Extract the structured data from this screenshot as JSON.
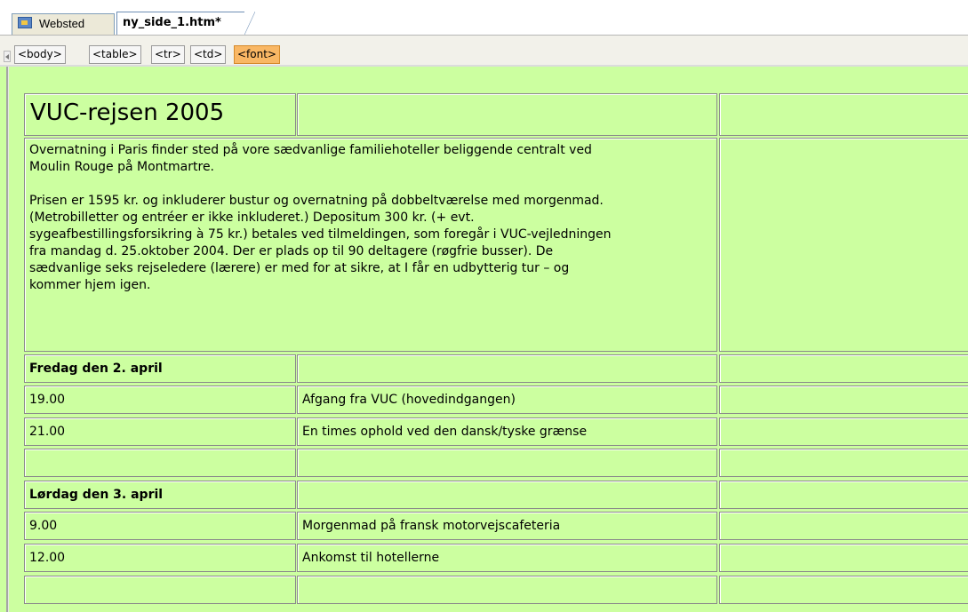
{
  "tabs": {
    "site_label": "Websted",
    "page_label": "ny_side_1.htm*"
  },
  "tag_selector": [
    "<body>",
    "<table>",
    "<tr>",
    "<td>",
    "<font>"
  ],
  "page": {
    "title": "VUC-rejsen 2005",
    "intro": [
      "Overnatning i Paris finder sted på vore sædvanlige familiehoteller beliggende centralt ved",
      "Moulin Rouge på Montmartre.",
      "",
      "Prisen er 1595 kr. og inkluderer bustur og overnatning på dobbeltværelse med morgenmad.",
      "(Metrobilletter og entréer er ikke inkluderet.) Depositum 300 kr. (+ evt.",
      "sygeafbestillingsforsikring à 75 kr.) betales ved tilmeldingen, som foregår i VUC-vejledningen",
      "fra mandag d. 25.oktober 2004. Der er plads op til 90 deltagere (røgfrie busser). De",
      "sædvanlige seks rejseledere (lærere) er med for at sikre, at I får en udbytterig tur – og",
      "kommer hjem igen."
    ],
    "day1": "Fredag den 2. april",
    "day1_rows": [
      {
        "time": "19.00",
        "activity": "Afgang fra VUC (hovedindgangen)"
      },
      {
        "time": "21.00",
        "activity": "En times ophold ved den dansk/tyske grænse"
      }
    ],
    "day2": "Lørdag den 3. april",
    "day2_rows": [
      {
        "time": "9.00",
        "activity": "Morgenmad på fransk motorvejscafeteria"
      },
      {
        "time": "12.00",
        "activity": "Ankomst til hotellerne"
      }
    ]
  },
  "colors": {
    "canvas_bg": "#ccffa0",
    "active_tag": "#f9b764"
  }
}
